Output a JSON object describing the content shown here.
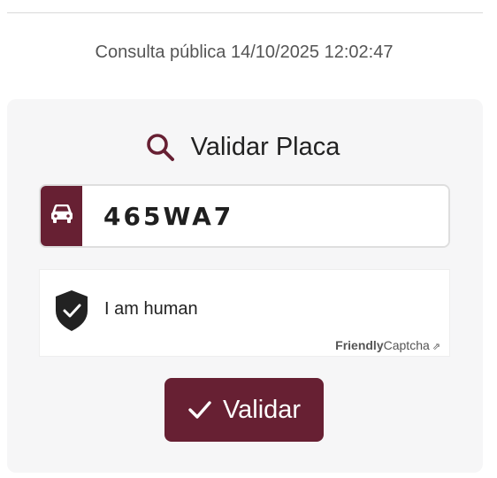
{
  "header": {
    "timestamp": "Consulta pública 14/10/2025 12:02:47"
  },
  "card": {
    "title": "Validar Placa",
    "title_icon": "search-icon"
  },
  "plate": {
    "addon_icon": "car-icon",
    "value": "465WA7"
  },
  "captcha": {
    "status_icon": "shield-check-icon",
    "status_text": "I am human",
    "brand_strong": "Friendly",
    "brand_light": "Captcha",
    "external_link_icon": "⇗"
  },
  "actions": {
    "validate_label": "Validar",
    "validate_icon": "checkmark-icon"
  },
  "colors": {
    "brand": "#672033",
    "card_background": "#f6f6f7"
  }
}
